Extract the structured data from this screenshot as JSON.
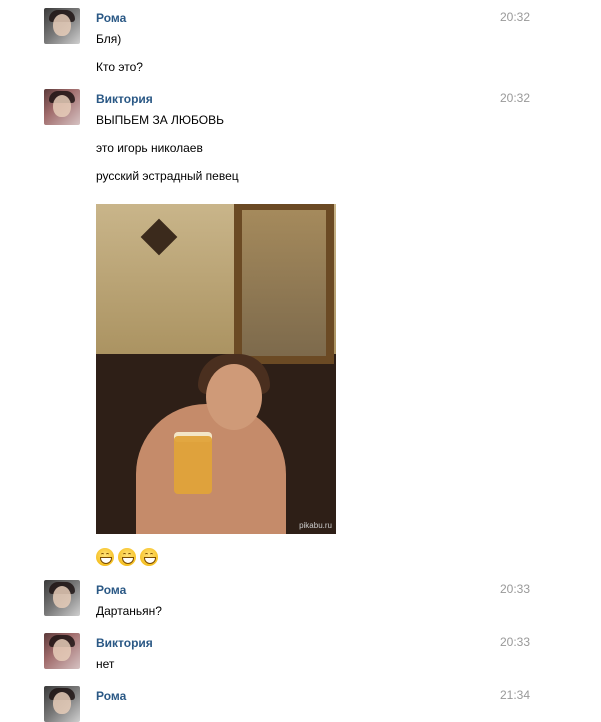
{
  "messages": [
    {
      "author": "Рома",
      "time": "20:32",
      "lines": [
        "Бля)",
        "Кто это?"
      ]
    },
    {
      "author": "Виктория",
      "time": "20:32",
      "lines": [
        "ВЫПЬЕМ ЗА ЛЮБОВЬ",
        "это игорь николаев",
        "русский эстрадный певец"
      ],
      "attachment": {
        "watermark": "pikabu.ru"
      },
      "emoji": [
        "grinning-face",
        "grinning-face",
        "grinning-face"
      ]
    },
    {
      "author": "Рома",
      "time": "20:33",
      "lines": [
        "Дартаньян?"
      ]
    },
    {
      "author": "Виктория",
      "time": "20:33",
      "lines": [
        "нет"
      ]
    },
    {
      "author": "Рома",
      "time": "21:34",
      "lines": []
    }
  ]
}
